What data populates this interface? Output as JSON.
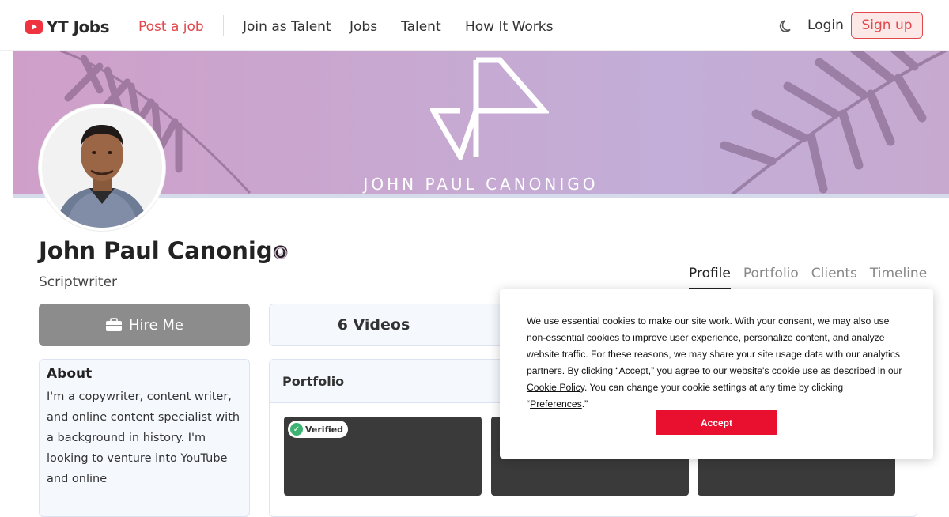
{
  "nav": {
    "brand": "YT Jobs",
    "links": [
      "Post a job",
      "Join as Talent",
      "Jobs",
      "Talent",
      "How It Works"
    ],
    "login": "Login",
    "signup": "Sign up",
    "theme_icon": "moon-icon",
    "accent_color": "#e2474b"
  },
  "banner": {
    "name": "JOHN PAUL CANONIGO"
  },
  "profile": {
    "name": "John Paul Canonigo",
    "role": "Scriptwriter",
    "hire_label": "Hire Me",
    "tabs": [
      "Profile",
      "Portfolio",
      "Clients",
      "Timeline"
    ],
    "active_tab": "Profile"
  },
  "about": {
    "title": "About",
    "text": "I'm a copywriter, content writer, and online content specialist with a background in history. I'm looking to venture into YouTube and online"
  },
  "stats": {
    "videos": "6 Videos"
  },
  "portfolio": {
    "title": "Portfolio",
    "verified_label": "Verified"
  },
  "cookie": {
    "text_1": "We use essential cookies to make our site work. With your consent, we may also use non-essential cookies to improve user experience, personalize content, and analyze website traffic. For these reasons, we may share your site usage data with our analytics partners. By clicking “Accept,” you agree to our website's cookie use as described in our ",
    "cookie_policy_link": "Cookie Policy",
    "text_2": ". You can change your cookie settings at any time by clicking “",
    "preferences_link": "Preferences",
    "text_3": ".”",
    "accept": "Accept",
    "accept_color": "#e8102e"
  }
}
